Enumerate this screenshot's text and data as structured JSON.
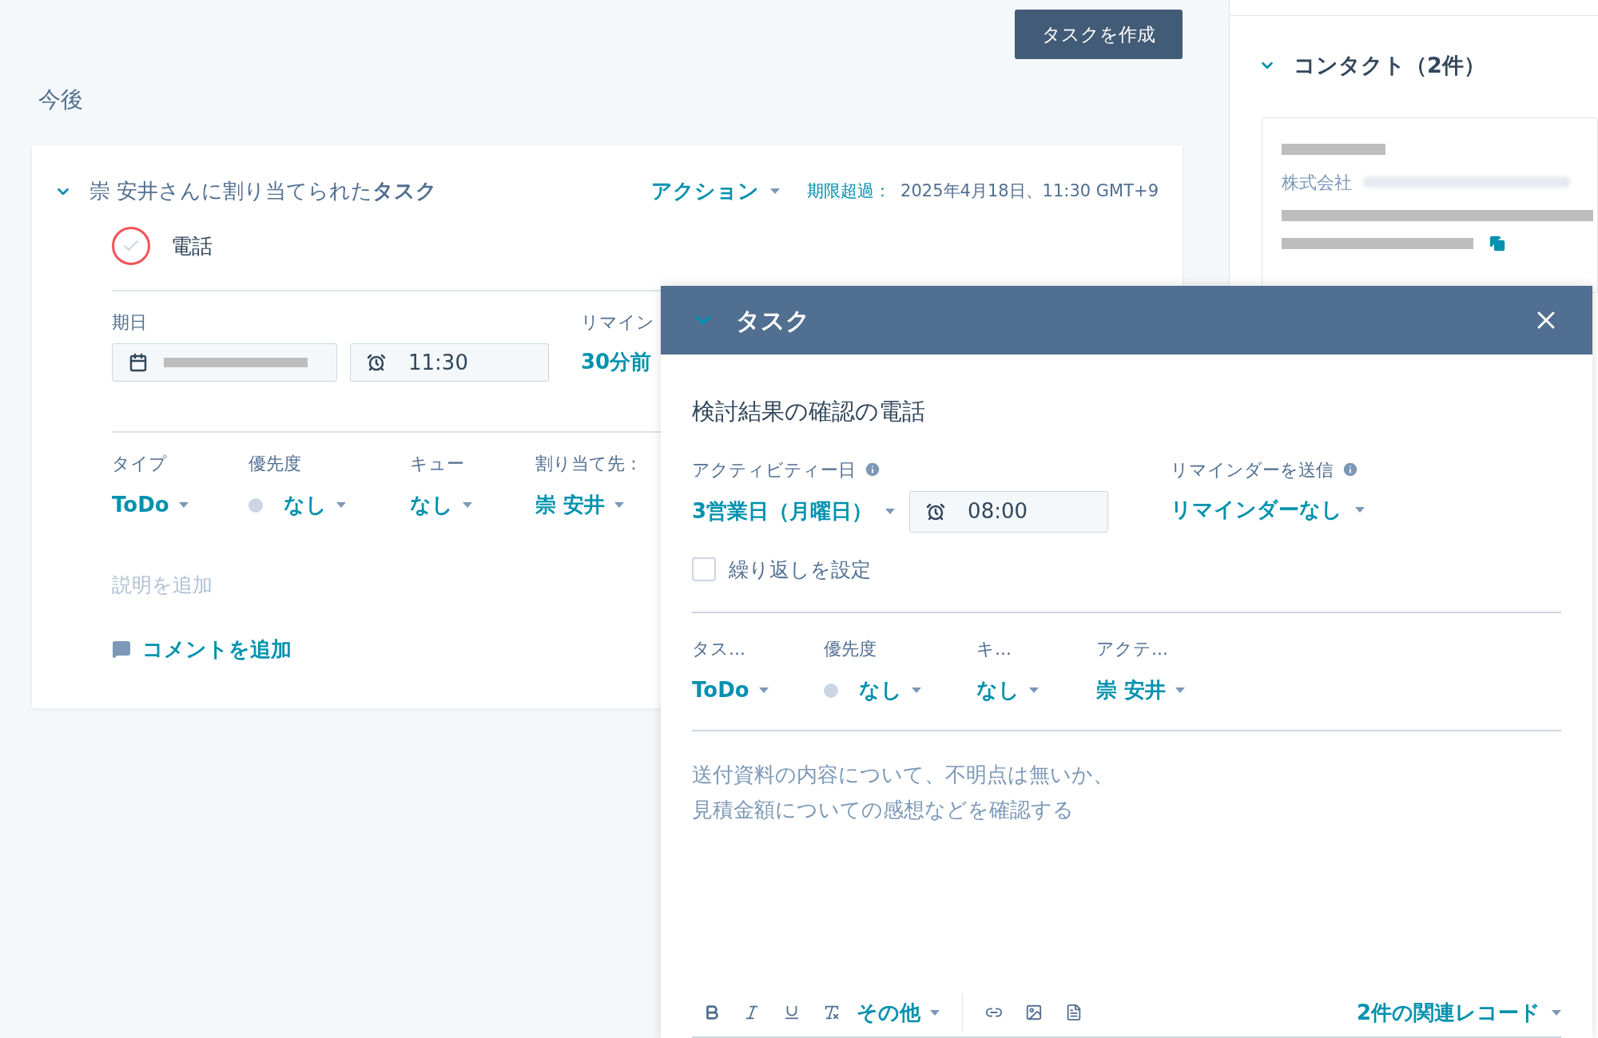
{
  "create_button": "タスクを作成",
  "section_title": "今後",
  "task_card": {
    "expanded": true,
    "heading": "崇 安井さんに割り当てられた**タスク**",
    "actions": "アクション",
    "overdue_label": "期限超過：",
    "overdue_date": "2025年4月18日、11:30 GMT+9",
    "completed": false,
    "task_type": "電話",
    "due_label": "期日",
    "due_time": "11:30",
    "reminder_label": "リマイン",
    "reminder_value": "30分前",
    "fields": [
      {
        "kind": "dropdown",
        "label": "タイプ",
        "value": "ToDo"
      },
      {
        "kind": "priority",
        "label": "優先度",
        "value": "なし"
      },
      {
        "kind": "dropdown",
        "label": "キュー",
        "value": "なし"
      },
      {
        "kind": "dropdown",
        "label": "割り当て先：",
        "value": "崇 安井"
      }
    ],
    "description_placeholder": "説明を追加",
    "comment_link": "コメントを追加"
  },
  "contacts": {
    "expanded": true,
    "title": "コンタクト（2件）",
    "company": "株式会社"
  },
  "task_modal": {
    "expanded": true,
    "title": "タスク",
    "subject": "検討結果の確認の電話",
    "activity_date_label": "アクティビティー日",
    "activity_date": "3営業日（月曜日）",
    "time": "08:00",
    "reminder_label": "リマインダーを送信",
    "reminder_value": "リマインダーなし",
    "repeat": {
      "label": "繰り返しを設定",
      "checked": false
    },
    "fields": [
      {
        "kind": "dropdown",
        "label": "タス...",
        "value": "ToDo"
      },
      {
        "kind": "priority",
        "label": "優先度",
        "value": "なし"
      },
      {
        "kind": "dropdown",
        "label": "キ...",
        "value": "なし"
      },
      {
        "kind": "dropdown",
        "label": "アクテ...",
        "value": "崇 安井"
      }
    ],
    "description": [
      "送付資料の内容について、不明点は無いか、",
      "見積金額についての感想などを確認する"
    ],
    "toolbar": {
      "more": "その他",
      "related": "2件の関連レコード"
    }
  }
}
